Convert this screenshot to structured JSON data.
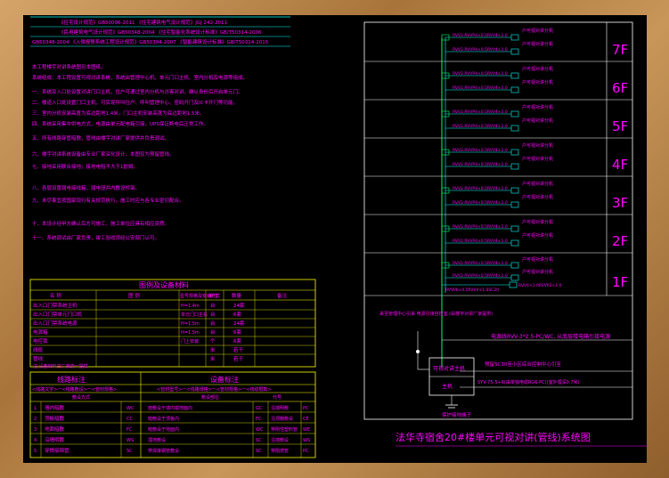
{
  "drawing": {
    "title": "法华寺宿舍20#楼单元可视对讲(管线)系统图",
    "floors": [
      "7F",
      "6F",
      "5F",
      "4F",
      "3F",
      "2F",
      "1F"
    ],
    "floor_cable_label": "RVV2 RVVP4×0.5RVV4×1.0",
    "floor_end_label": "户可视对讲分机",
    "floor_end_label2": "户可视对讲分机",
    "floor_ground_label": "RVVP2 RVV4×0.5+RVV4×1.0",
    "ground_floor_labels": [
      "RVV4×1.0RVVP2×1.0",
      "RVVP6×0.5RVV4×1.0SC20",
      "RVV4×0.5RVV4×1.0SC20",
      "安防系统接地端子"
    ],
    "mgmt_note": "来至管理中心引来 电源引接自控室 (由楼宇对讲厂家提供)",
    "power_note": "电源线RVV-3*2.5-PC/WC, 从底层楼电箱引接电源",
    "signal_note": "预留SC30至小区综合控制中心引至",
    "cable_note": "SYV-75-5+6(由单独电缆RG6-PC)(室外埋深0.7米)",
    "device_box": "可视对讲主机",
    "device_sub": "主机",
    "ground_label": "接地",
    "earth_label": "保护接地端子"
  },
  "notes": {
    "standards": [
      "《住宅设计规范》GB50096-2011   《住宅建筑电气设计规范》JGJ 242-2011",
      "《民用建筑电气设计规范》GB50348-2004   《住宅智能化系统设计标准》GB/T50314-2006",
      "GB50348-2004   《入侵报警系统工程设计规范》GB50394-2007   《智能建筑设计标准》GB/T50314-2015"
    ],
    "paragraphs": [
      "本工程楼宇对讲系统图见本图纸。",
      "系统组成：本工程设置可视对讲系统，系统由管理中心机、单元门口主机、室内分机及电源等组成。",
      "一、系统及入口处设置对讲门口主机，住户可通过室内分机与访客对讲，确认身份后开启单元门。",
      "二、楼道入口处设置门口主机，可实现呼叫住户、呼叫管理中心、密码开门及IC卡开门等功能。",
      "三、室内分机安装高度为底边距地1.4米，门口主机安装高度为底边距地1.5米。",
      "四、系统采用集中供电方式，电源由单元配电箱引接，UPS保证断电后正常工作。",
      "五、所有线路穿管暗敷，管线由楼宇对讲厂家提供并负责调试。",
      "六、楼宇对讲系统设备由专业厂家深化设计，本图仅为预留管线。",
      "七、接地采用联合接地，接地电阻不大于1欧姆。",
      "八、各层设置弱电接线箱，弱电竖井内敷设桥架。",
      "九、未尽事宜按国家现行有关规范执行，施工时应与各专业密切配合。",
      "十、本设计经甲方确认后方可施工，施工单位应具有相应资质。",
      "十一、系统调试由厂家负责，竣工验收须经公安部门认可。"
    ]
  },
  "legend_table": {
    "title": "图例及设备材料",
    "headers": [
      "名  称",
      "图  例",
      "型号规格及安装方式",
      "单位",
      "数量",
      "备注"
    ],
    "rows": [
      [
        "出入口门禁系统主机",
        "",
        "H=1.4m",
        "台",
        "24套"
      ],
      [
        "出入口门禁单元门口机",
        "",
        "单元门口主机",
        "台",
        "6套"
      ],
      [
        "出入口门禁系统电源",
        "",
        "H=1.5m",
        "台",
        "24套"
      ],
      [
        "电源箱",
        "",
        "H=1.5m",
        "台",
        "6套"
      ],
      [
        "电控锁",
        "",
        "门上安装",
        "个",
        "6套"
      ],
      [
        "线缆",
        "",
        "",
        "米",
        "若干"
      ],
      [
        "管线",
        "",
        "",
        "米",
        "若干"
      ]
    ],
    "footer": "注:设备材料由厂家统一提供"
  },
  "line_table": {
    "left_title": "线路标注",
    "left_sub": "<线路文字>一<线路敷设>一<管材规格>",
    "right_title": "设备标注",
    "right_sub": "<管材型号>一<线路规格>一<管材规格>一<线缆根数>",
    "col_headers": [
      "敷设方式",
      "敷设部位",
      "代号"
    ],
    "left_rows": [
      [
        "墙内暗敷",
        "WC"
      ],
      [
        "顶板暗敷",
        "CC"
      ],
      [
        "地面暗敷",
        "FC"
      ],
      [
        "沿墙明敷",
        "WS"
      ],
      [
        "穿焊接钢管",
        "SC"
      ]
    ],
    "right_rows": [
      [
        "暗敷设于墙内或地面内",
        "GC",
        "沿墙明敷",
        "PC"
      ],
      [
        "暗敷设于顶板内",
        "FC",
        "沿顶棚敷设",
        "CE"
      ],
      [
        "暗敷设于地面内",
        "WC",
        "穿刚性塑料管",
        "WE"
      ],
      [
        "埋地敷设",
        "SC",
        "沿墙敷设",
        "WS"
      ],
      [
        "穿焊接钢管敷设",
        "SC",
        "穿阻燃管",
        "PC"
      ]
    ]
  },
  "colors": {
    "magenta": "#ff00ff",
    "green": "#00ff66",
    "yellow": "#ffff00",
    "cyan": "#00ffff",
    "white": "#ffffff",
    "frame": "#b88848"
  }
}
